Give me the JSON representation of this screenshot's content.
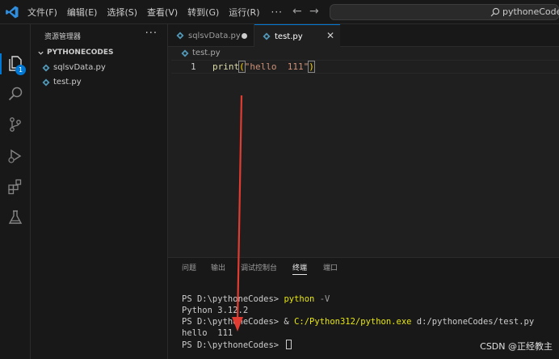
{
  "titlebar": {
    "menus": [
      "文件(F)",
      "编辑(E)",
      "选择(S)",
      "查看(V)",
      "转到(G)",
      "运行(R)"
    ],
    "more": "···",
    "search_text": "pythoneCodes"
  },
  "activitybar": {
    "icons": [
      "explorer-icon",
      "search-icon",
      "source-control-icon",
      "run-debug-icon",
      "extensions-icon",
      "testing-icon"
    ],
    "badge": "1"
  },
  "sidebar": {
    "title": "资源管理器",
    "more": "···",
    "folder": "PYTHONECODES",
    "files": [
      "sqlsvData.py",
      "test.py"
    ]
  },
  "tabs": [
    {
      "label": "sqlsvData.py",
      "modified": true
    },
    {
      "label": "test.py",
      "active": true
    }
  ],
  "editor": {
    "breadcrumb": "test.py",
    "line_number": "1",
    "code": {
      "fn": "print",
      "open": "(",
      "str": "\"hello  111\"",
      "close": ")"
    }
  },
  "panel": {
    "tabs": [
      "问题",
      "输出",
      "调试控制台",
      "终端",
      "端口"
    ],
    "active_tab": "终端",
    "terminal": {
      "l1_prompt": "PS D:\\pythoneCodes> ",
      "l1_cmd": "python",
      "l1_arg": " -V",
      "l2": "Python 3.12.2",
      "l3_prompt": "PS D:\\pythoneCodes> & ",
      "l3_cmd": "C:/Python312/python.exe",
      "l3_arg": " d:/pythoneCodes/test.py",
      "l4": "hello  111",
      "l5_prompt": "PS D:\\pythoneCodes> "
    }
  },
  "watermark": "CSDN @正经教主",
  "colors": {
    "accent": "#0078d4",
    "arrow": "#e03c31"
  }
}
